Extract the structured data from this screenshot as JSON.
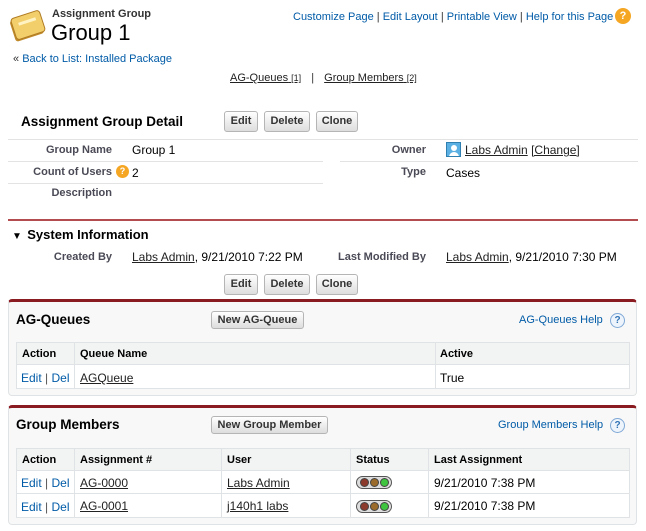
{
  "header": {
    "object_label": "Assignment Group",
    "record_title": "Group 1",
    "back_link": "Back to List: Installed Package",
    "back_prefix": "«",
    "top_links": [
      "Customize Page",
      "Edit Layout",
      "Printable View",
      "Help for this Page"
    ],
    "help_icon": "?",
    "related_links": [
      {
        "label": "AG-Queues",
        "count": "[1]"
      },
      {
        "label": "Group Members",
        "count": "[2]"
      }
    ],
    "related_sep": "|"
  },
  "detail": {
    "title": "Assignment Group Detail",
    "buttons": [
      "Edit",
      "Delete",
      "Clone"
    ],
    "fields": {
      "group_name_label": "Group Name",
      "group_name_value": "Group 1",
      "count_label": "Count of Users",
      "count_value": "2",
      "description_label": "Description",
      "owner_label": "Owner",
      "owner_value": "Labs Admin",
      "owner_change": "[Change]",
      "type_label": "Type",
      "type_value": "Cases"
    },
    "system_info": {
      "title": "System Information",
      "created_by_label": "Created By",
      "created_by_user": "Labs Admin",
      "created_by_date": ", 9/21/2010 7:22 PM",
      "last_modified_label": "Last Modified By",
      "last_modified_user": "Labs Admin",
      "last_modified_date": ", 9/21/2010 7:30 PM"
    }
  },
  "ag_queues": {
    "title": "AG-Queues",
    "new_button": "New AG-Queue",
    "help_link": "AG-Queues Help",
    "columns": [
      "Action",
      "Queue Name",
      "Active"
    ],
    "rows": [
      {
        "edit": "Edit",
        "sep": "|",
        "del": "Del",
        "queue_name": "AGQueue",
        "active": "True"
      }
    ]
  },
  "group_members": {
    "title": "Group Members",
    "new_button": "New Group Member",
    "help_link": "Group Members Help",
    "columns": [
      "Action",
      "Assignment #",
      "User",
      "Status",
      "Last Assignment"
    ],
    "rows": [
      {
        "edit": "Edit",
        "sep": "|",
        "del": "Del",
        "assignment": "AG-0000",
        "user": "Labs Admin",
        "status": "green",
        "last_assignment": "9/21/2010 7:38 PM"
      },
      {
        "edit": "Edit",
        "sep": "|",
        "del": "Del",
        "assignment": "AG-0001",
        "user": "j140h1 labs",
        "status": "green",
        "last_assignment": "9/21/2010 7:38 PM"
      }
    ]
  },
  "colors": {
    "accent_red": "#8a1c21",
    "link_blue": "#015ba7",
    "status_green": "#3ec43e"
  }
}
